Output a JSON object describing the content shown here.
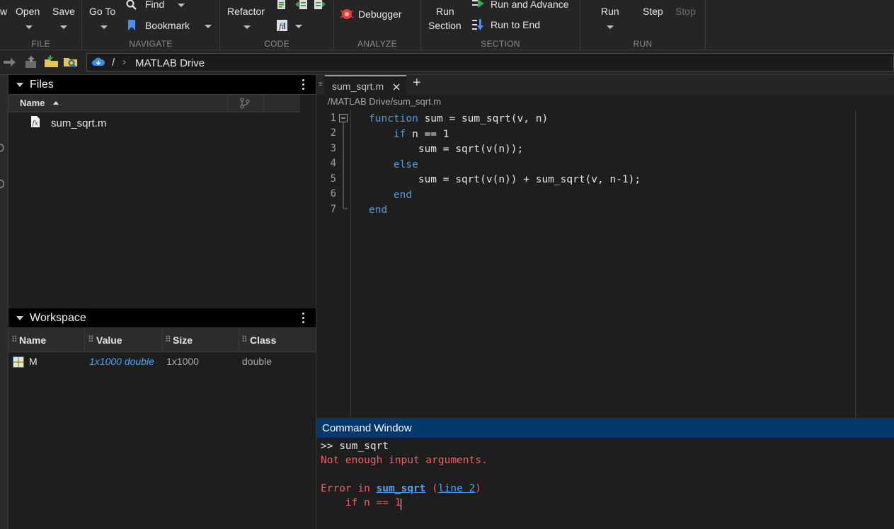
{
  "toolstrip": {
    "file": {
      "label": "FILE",
      "partial_new": "w",
      "open": "Open",
      "save": "Save"
    },
    "navigate": {
      "label": "NAVIGATE",
      "goto": "Go To",
      "find": "Find",
      "bookmark": "Bookmark"
    },
    "code": {
      "label": "CODE",
      "refactor": "Refactor"
    },
    "analyze": {
      "label": "ANALYZE",
      "debugger": "Debugger"
    },
    "section": {
      "label": "SECTION",
      "run_section_1": "Run",
      "run_section_2": "Section",
      "run_and_advance": "Run and Advance",
      "run_to_end": "Run to End"
    },
    "run": {
      "label": "RUN",
      "run": "Run",
      "step": "Step",
      "stop": "Stop"
    }
  },
  "address": {
    "separator": "/",
    "chevron": "›",
    "location": "MATLAB Drive"
  },
  "files_panel": {
    "title": "Files",
    "column_name": "Name",
    "items": [
      {
        "name": "sum_sqrt.m",
        "icon": "function-file-icon"
      }
    ]
  },
  "workspace_panel": {
    "title": "Workspace",
    "columns": [
      "Name",
      "Value",
      "Size",
      "Class"
    ],
    "rows": [
      {
        "name": "M",
        "value": "1x1000 double",
        "size": "1x1000",
        "class": "double"
      }
    ]
  },
  "editor": {
    "tab_label": "sum_sqrt.m",
    "add_tab": "+",
    "path": "/MATLAB Drive/sum_sqrt.m",
    "line_numbers": [
      "1",
      "2",
      "3",
      "4",
      "5",
      "6",
      "7"
    ],
    "lines": [
      {
        "indent": "",
        "kw": "function",
        "rest": " sum = sum_sqrt(v, n)"
      },
      {
        "indent": "    ",
        "kw": "if",
        "rest": " n == 1"
      },
      {
        "indent": "        ",
        "kw": "",
        "rest": "sum = sqrt(v(n));"
      },
      {
        "indent": "    ",
        "kw": "else",
        "rest": ""
      },
      {
        "indent": "        ",
        "kw": "",
        "rest": "sum = sqrt(v(n)) + sum_sqrt(v, n-1);"
      },
      {
        "indent": "    ",
        "kw": "end",
        "rest": ""
      },
      {
        "indent": "",
        "kw": "end",
        "rest": ""
      }
    ]
  },
  "command_window": {
    "title": "Command Window",
    "prompt_line": ">> sum_sqrt",
    "error_message": "Not enough input arguments.",
    "error_prefix": "Error in ",
    "error_func": "sum_sqrt",
    "error_paren_open": " (",
    "error_line_link": "line 2",
    "error_paren_close": ")",
    "error_code": "    if n == 1"
  },
  "colors": {
    "accent": "#03396c",
    "keyword": "#569cd6",
    "error": "#f06060",
    "link": "#4aa3ff"
  }
}
